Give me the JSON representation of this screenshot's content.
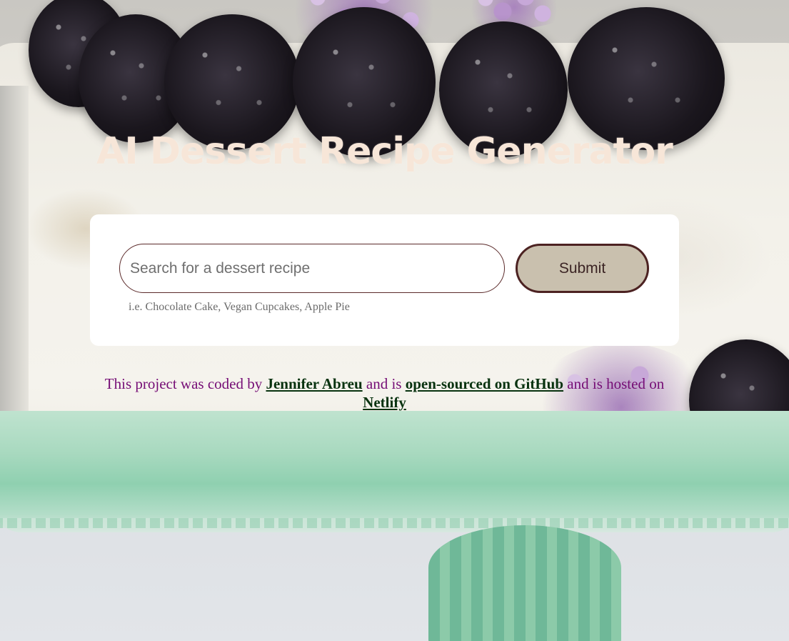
{
  "page": {
    "title": "AI Dessert Recipe Generator"
  },
  "search": {
    "placeholder": "Search for a dessert recipe",
    "value": "",
    "submit_label": "Submit",
    "hint": "i.e. Chocolate Cake, Vegan Cupcakes, Apple Pie"
  },
  "footer": {
    "prefix": "This project was coded by",
    "author_link": "Jennifer Abreu",
    "middle": "and is",
    "github_link": "open-sourced on GitHub",
    "suffix": "and is hosted on",
    "netlify_link": "Netlify"
  },
  "colors": {
    "title": "#f7e6d8",
    "footer_text": "#750d75",
    "link": "#08320f",
    "button_bg": "#c9c0ae",
    "button_border": "#4c2222"
  }
}
